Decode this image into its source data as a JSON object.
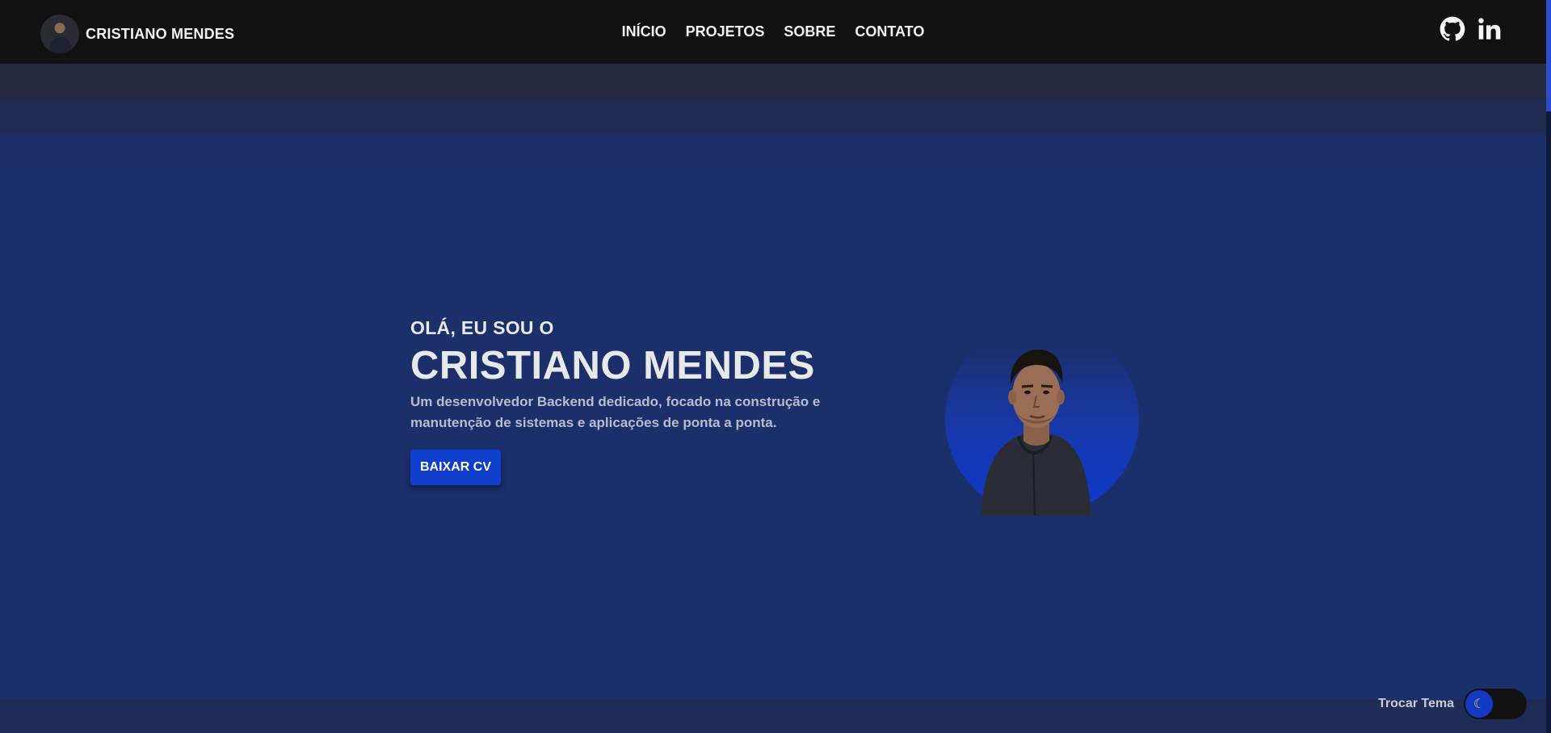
{
  "header": {
    "brand_name": "CRISTIANO MENDES",
    "nav": [
      "INÍCIO",
      "PROJETOS",
      "SOBRE",
      "CONTATO"
    ],
    "socials": [
      "github-icon",
      "linkedin-icon"
    ]
  },
  "hero": {
    "greeting": "OLÁ, EU SOU O",
    "name": "CRISTIANO MENDES",
    "description": "Um desenvolvedor Backend dedicado, focado na construção e manutenção de sistemas e aplicações de ponta a ponta.",
    "cta_label": "BAIXAR CV"
  },
  "theme": {
    "label": "Trocar Tema",
    "icon": "moon-icon"
  },
  "colors": {
    "navbar_bg": "#111111",
    "hero_bg": "#1b2f6b",
    "accent": "#0f3dcc"
  }
}
